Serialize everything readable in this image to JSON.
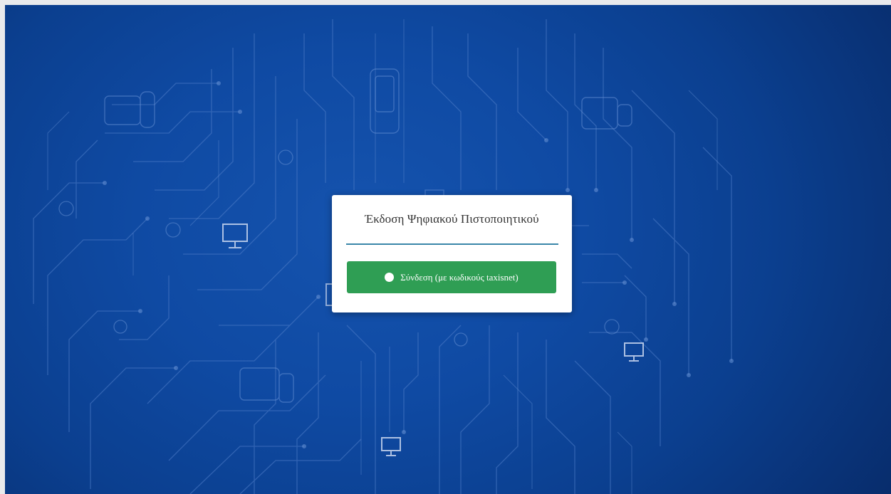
{
  "background": {
    "color_primary": "#0f4aa3",
    "color_dark": "#082c6b",
    "decoration": "circuit-board-pattern"
  },
  "dialog": {
    "title": "Έκδοση Ψηφιακού Πιστοποιητικού",
    "accent_rule_color": "#3a86a8",
    "login_button": {
      "label": "Σύνδεση (με κωδικούς taxisnet)",
      "icon": "user-circle-icon",
      "color": "#2f9e54"
    }
  }
}
